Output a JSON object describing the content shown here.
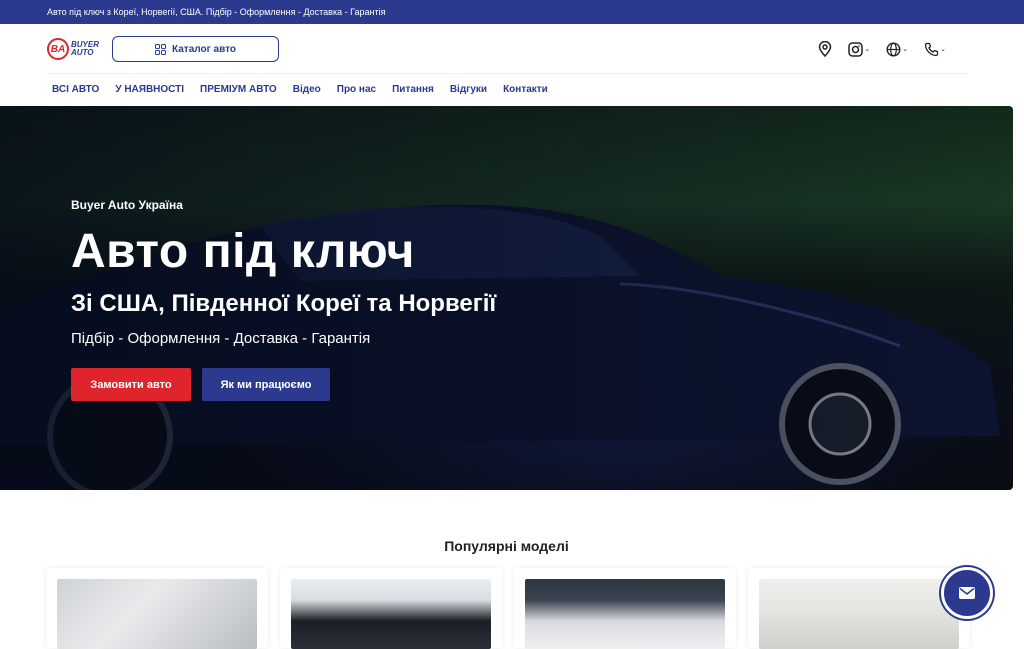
{
  "topbar": {
    "text": "Авто під ключ з Кореї, Норвегії, США. Підбір - Оформлення - Доставка - Гарантія"
  },
  "logo": {
    "badge": "BA",
    "line1": "BUYER",
    "line2": "AUTO"
  },
  "header": {
    "catalog_label": "Каталог авто"
  },
  "icons": [
    "location-icon",
    "instagram-icon",
    "globe-icon",
    "phone-icon"
  ],
  "nav": {
    "items": [
      "ВСІ АВТО",
      "У НАЯВНОСТІ",
      "ПРЕМІУМ АВТО",
      "Відео",
      "Про нас",
      "Питання",
      "Відгуки",
      "Контакти"
    ]
  },
  "hero": {
    "eyebrow": "Buyer Auto Україна",
    "title": "Авто під ключ",
    "subtitle": "Зі США, Південної Кореї та Норвегії",
    "tagline": "Підбір - Оформлення - Доставка - Гарантія",
    "cta_primary": "Замовити авто",
    "cta_secondary": "Як ми працюємо"
  },
  "popular": {
    "title": "Популярні моделі"
  },
  "colors": {
    "brand_blue": "#2b3a8f",
    "brand_red": "#e0242b"
  }
}
